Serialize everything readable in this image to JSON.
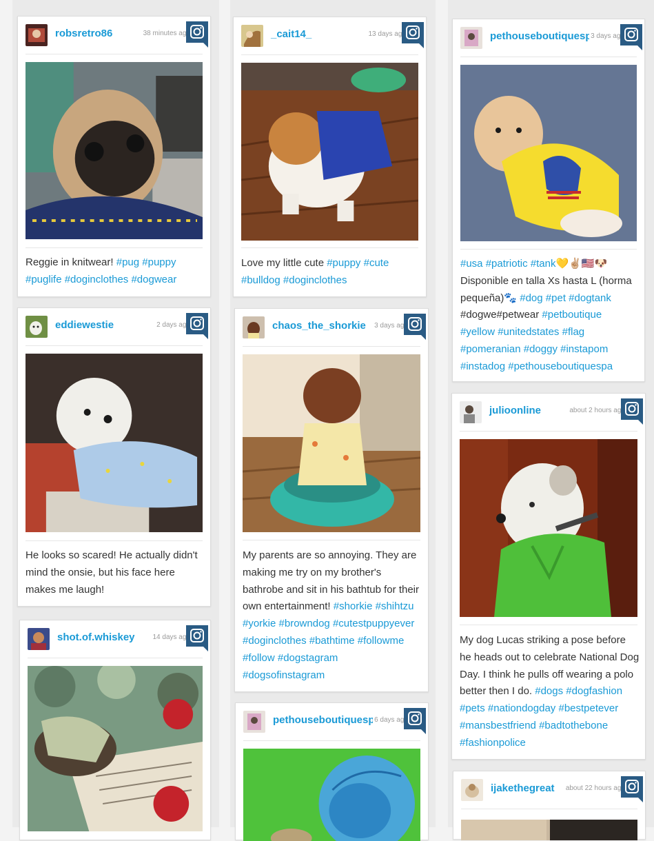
{
  "theme": {
    "accent": "#1a9ad6",
    "text": "#333333",
    "muted": "#9a9a9a",
    "instagram_badge": "#2a5b84"
  },
  "posts": [
    {
      "username": "robsretro86",
      "time": "38 minutes ago",
      "photo": "pug-in-knit-sweater",
      "caption": [
        {
          "t": "Reggie in knitwear! "
        },
        {
          "t": "#pug",
          "tag": true
        },
        {
          "t": " "
        },
        {
          "t": "#puppy",
          "tag": true
        },
        {
          "t": " "
        },
        {
          "t": "#puglife",
          "tag": true
        },
        {
          "t": " "
        },
        {
          "t": "#doginclothes",
          "tag": true
        },
        {
          "t": " "
        },
        {
          "t": "#dogwear",
          "tag": true
        }
      ]
    },
    {
      "username": "_cait14_",
      "time": "13 days ago",
      "photo": "bulldog-puppy-in-blue-shirt",
      "caption": [
        {
          "t": "Love my little cute "
        },
        {
          "t": "#puppy",
          "tag": true
        },
        {
          "t": " "
        },
        {
          "t": "#cute",
          "tag": true
        },
        {
          "t": " "
        },
        {
          "t": "#bulldog",
          "tag": true
        },
        {
          "t": " "
        },
        {
          "t": "#doginclothes",
          "tag": true
        }
      ]
    },
    {
      "username": "pethouseboutiquespa",
      "time": "3 days ago",
      "photo": "pomeranian-in-usa-tank",
      "caption": [
        {
          "t": "#usa",
          "tag": true
        },
        {
          "t": " "
        },
        {
          "t": "#patriotic",
          "tag": true
        },
        {
          "t": " "
        },
        {
          "t": "#tank",
          "tag": true
        },
        {
          "t": "💛✌🏼🇺🇸🐶 Disponible en talla Xs hasta L (horma pequeña)🐾 "
        },
        {
          "t": "#dog",
          "tag": true
        },
        {
          "t": " "
        },
        {
          "t": "#pet",
          "tag": true
        },
        {
          "t": " "
        },
        {
          "t": "#dogtank",
          "tag": true
        },
        {
          "t": " #dogwe#petwear "
        },
        {
          "t": "#petboutique",
          "tag": true
        },
        {
          "t": " "
        },
        {
          "t": "#yellow",
          "tag": true
        },
        {
          "t": " "
        },
        {
          "t": "#unitedstates",
          "tag": true
        },
        {
          "t": " "
        },
        {
          "t": "#flag",
          "tag": true
        },
        {
          "t": " "
        },
        {
          "t": "#pomeranian",
          "tag": true
        },
        {
          "t": " "
        },
        {
          "t": "#doggy",
          "tag": true
        },
        {
          "t": " "
        },
        {
          "t": "#instapom",
          "tag": true
        },
        {
          "t": " "
        },
        {
          "t": "#instadog",
          "tag": true
        },
        {
          "t": " "
        },
        {
          "t": "#pethouseboutiquespa",
          "tag": true
        }
      ]
    },
    {
      "username": "eddiewestie",
      "time": "2 days ago",
      "photo": "westie-in-pajamas",
      "caption": [
        {
          "t": "He looks so scared! He actually didn't mind the onsie, but his face here makes me laugh!"
        }
      ]
    },
    {
      "username": "chaos_the_shorkie",
      "time": "3 days ago",
      "photo": "shorkie-in-bathrobe-and-tub",
      "caption": [
        {
          "t": "My parents are so annoying. They are making me try on my brother's bathrobe and sit in his bathtub for their own entertainment! "
        },
        {
          "t": "#shorkie",
          "tag": true
        },
        {
          "t": " "
        },
        {
          "t": "#shihtzu",
          "tag": true
        },
        {
          "t": " "
        },
        {
          "t": "#yorkie",
          "tag": true
        },
        {
          "t": " "
        },
        {
          "t": "#browndog",
          "tag": true
        },
        {
          "t": " "
        },
        {
          "t": "#cutestpuppyever",
          "tag": true
        },
        {
          "t": " "
        },
        {
          "t": "#doginclothes",
          "tag": true
        },
        {
          "t": " "
        },
        {
          "t": "#bathtime",
          "tag": true
        },
        {
          "t": " "
        },
        {
          "t": "#followme",
          "tag": true
        },
        {
          "t": " "
        },
        {
          "t": "#follow",
          "tag": true
        },
        {
          "t": " "
        },
        {
          "t": "#dogstagram",
          "tag": true
        },
        {
          "t": " "
        },
        {
          "t": "#dogsofinstagram",
          "tag": true
        }
      ]
    },
    {
      "username": "julioonline",
      "time": "about 2 hours ago",
      "photo": "dog-in-green-polo",
      "caption": [
        {
          "t": "My dog Lucas striking a pose before he heads out to celebrate National Dog Day. I think he pulls off wearing a polo better then I do. "
        },
        {
          "t": "#dogs",
          "tag": true
        },
        {
          "t": " "
        },
        {
          "t": "#dogfashion",
          "tag": true
        },
        {
          "t": " "
        },
        {
          "t": "#pets",
          "tag": true
        },
        {
          "t": " "
        },
        {
          "t": "#nationdogday",
          "tag": true
        },
        {
          "t": " "
        },
        {
          "t": "#bestpetever",
          "tag": true
        },
        {
          "t": " "
        },
        {
          "t": "#mansbestfriend",
          "tag": true
        },
        {
          "t": " "
        },
        {
          "t": "#badtothebone",
          "tag": true
        },
        {
          "t": " "
        },
        {
          "t": "#fashionpolice",
          "tag": true
        }
      ]
    },
    {
      "username": "shot.of.whiskey",
      "time": "14 days ago",
      "photo": "yorkie-in-striped-shirt-on-book",
      "caption": []
    },
    {
      "username": "pethouseboutiquespa",
      "time": "6 days ago",
      "photo": "dog-in-blue-tutu",
      "caption": []
    },
    {
      "username": "ijakethegreat",
      "time": "about 22 hours ago",
      "photo": "dog-photo-partial",
      "caption": []
    }
  ]
}
